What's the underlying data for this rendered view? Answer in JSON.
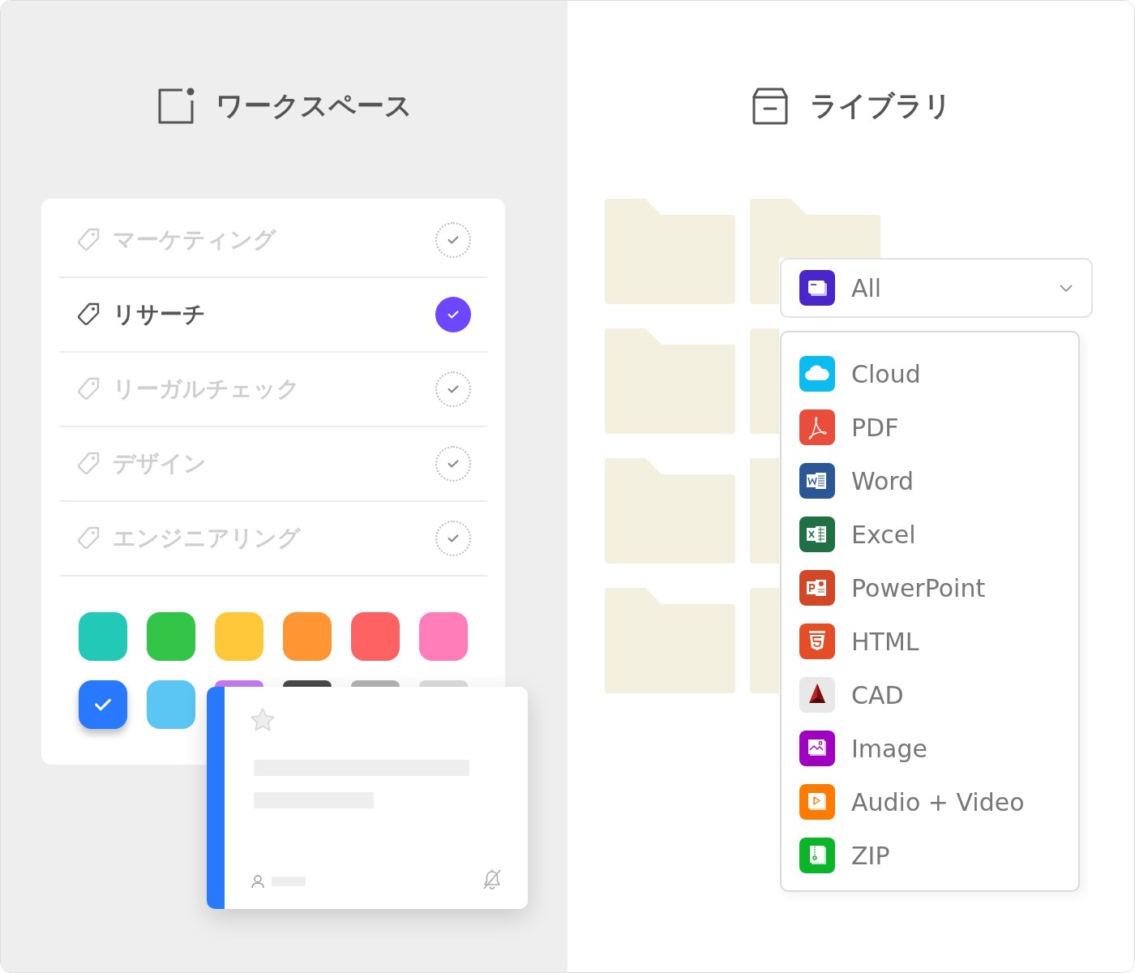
{
  "workspace": {
    "title": "ワークスペース",
    "tags": [
      {
        "label": "マーケティング",
        "selected": false
      },
      {
        "label": "リサーチ",
        "selected": true
      },
      {
        "label": "リーガルチェック",
        "selected": false
      },
      {
        "label": "デザイン",
        "selected": false
      },
      {
        "label": "エンジニアリング",
        "selected": false
      }
    ],
    "palette": [
      {
        "color": "#22c9b6",
        "selected": false
      },
      {
        "color": "#32c548",
        "selected": false
      },
      {
        "color": "#ffc83a",
        "selected": false
      },
      {
        "color": "#ff9533",
        "selected": false
      },
      {
        "color": "#ff6262",
        "selected": false
      },
      {
        "color": "#ff7eb9",
        "selected": false
      },
      {
        "color": "#2979ff",
        "selected": true
      },
      {
        "color": "#5bc5f4",
        "selected": false
      },
      {
        "color": "#c57cf2"
      },
      {
        "color": "#4a4a4a"
      },
      {
        "color": "#b3b3b3"
      },
      {
        "color": "#dcdcdc"
      }
    ],
    "card": {
      "starred": false,
      "notifications": false
    }
  },
  "library": {
    "title": "ライブラリ",
    "filter": {
      "value": "All",
      "kind": "all",
      "color": "#4a25c9",
      "options": [
        {
          "label": "Cloud",
          "kind": "cloud",
          "color": "#0bbcf0"
        },
        {
          "label": "PDF",
          "kind": "pdf",
          "color": "#e94e3c"
        },
        {
          "label": "Word",
          "kind": "word",
          "color": "#2b5797"
        },
        {
          "label": "Excel",
          "kind": "excel",
          "color": "#1f7044"
        },
        {
          "label": "PowerPoint",
          "kind": "powerpoint",
          "color": "#d24726"
        },
        {
          "label": "HTML",
          "kind": "html",
          "color": "#e44d26"
        },
        {
          "label": "CAD",
          "kind": "cad",
          "color": "#e8e8e8"
        },
        {
          "label": "Image",
          "kind": "image",
          "color": "#a000c0"
        },
        {
          "label": "Audio + Video",
          "kind": "media",
          "color": "#ff7a00"
        },
        {
          "label": "ZIP",
          "kind": "zip",
          "color": "#0ab52a"
        }
      ]
    }
  }
}
